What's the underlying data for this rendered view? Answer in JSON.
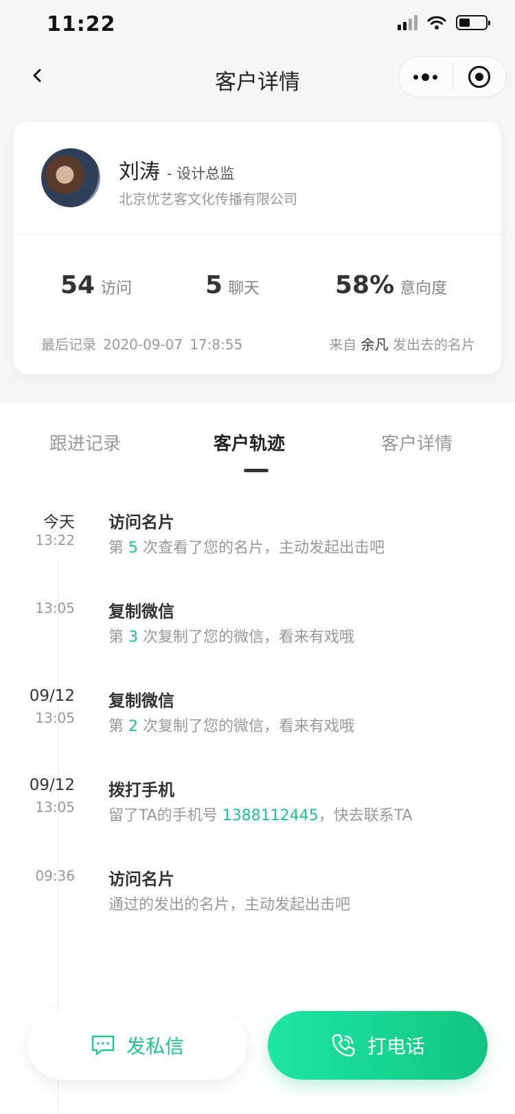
{
  "status_bar": {
    "time": "11:22"
  },
  "nav": {
    "title": "客户详情"
  },
  "profile": {
    "name": "刘涛",
    "title": "- 设计总监",
    "company": "北京优艺客文化传播有限公司"
  },
  "stats": [
    {
      "value": "54",
      "label": "访问"
    },
    {
      "value": "5",
      "label": "聊天"
    },
    {
      "value": "58%",
      "label": "意向度"
    }
  ],
  "last_record": {
    "label": "最后记录",
    "date": "2020-09-07",
    "time": "17:8:55"
  },
  "source": {
    "prefix": "来自",
    "name": "余凡",
    "suffix": "发出去的名片"
  },
  "tabs": [
    {
      "label": "跟进记录",
      "active": false
    },
    {
      "label": "客户轨迹",
      "active": true
    },
    {
      "label": "客户详情",
      "active": false
    }
  ],
  "timeline": [
    {
      "date": "今天",
      "time": "13:22",
      "title": "访问名片",
      "desc_pre": "第 ",
      "highlight": "5",
      "desc_post": " 次查看了您的名片，主动发起出击吧"
    },
    {
      "date": "",
      "time": "13:05",
      "title": "复制微信",
      "desc_pre": "第 ",
      "highlight": "3",
      "desc_post": " 次复制了您的微信，看来有戏哦"
    },
    {
      "date": "09/12",
      "time": "13:05",
      "title": "复制微信",
      "desc_pre": "第 ",
      "highlight": "2",
      "desc_post": " 次复制了您的微信，看来有戏哦"
    },
    {
      "date": "09/12",
      "time": "13:05",
      "title": "拨打手机",
      "desc_pre": "留了TA的手机号 ",
      "highlight": "1388112445",
      "desc_post": "，快去联系TA"
    },
    {
      "date": "",
      "time": "09:36",
      "title": "访问名片",
      "desc_pre": "通过的发出的名片，主动发起出击吧",
      "highlight": "",
      "desc_post": ""
    }
  ],
  "actions": {
    "message": "发私信",
    "call": "打电话"
  },
  "colors": {
    "accent": "#21c38c",
    "call_gradient_start": "#1ee6a2",
    "call_gradient_end": "#12c483"
  },
  "icons": {
    "back": "chevron-left-icon",
    "more": "more-dots-icon",
    "capsule_close": "target-icon",
    "message": "message-icon",
    "call": "phone-icon"
  }
}
